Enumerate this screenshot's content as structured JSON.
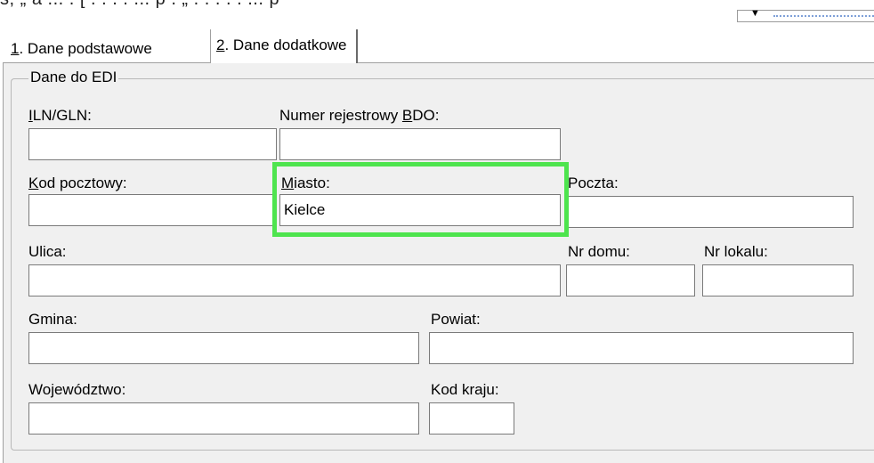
{
  "top_strip": {
    "clipped_text": "ś, „ a ... . [ . . . . ... p . „ . . . . . ... p"
  },
  "tabs": [
    {
      "key": "1",
      "label": "Dane podstawowe"
    },
    {
      "key": "2",
      "label": "Dane dodatkowe"
    }
  ],
  "group": {
    "title": "Dane do EDI"
  },
  "fields": {
    "iln": {
      "label_key": "I",
      "label_rest": "LN/GLN:",
      "value": ""
    },
    "bdo": {
      "label_pre": "Numer rejestrowy ",
      "label_key": "B",
      "label_rest": "DO:",
      "value": ""
    },
    "kod_pocztowy": {
      "label_key": "K",
      "label_rest": "od pocztowy:",
      "value": ""
    },
    "miasto": {
      "label_key": "M",
      "label_rest": "iasto:",
      "value": "Kielce"
    },
    "poczta": {
      "label": "Poczta:",
      "value": ""
    },
    "ulica": {
      "label": "Ulica:",
      "value": ""
    },
    "nr_domu": {
      "label": "Nr domu:",
      "value": ""
    },
    "nr_lokalu": {
      "label": "Nr lokalu:",
      "value": ""
    },
    "gmina": {
      "label": "Gmina:",
      "value": ""
    },
    "powiat": {
      "label": "Powiat:",
      "value": ""
    },
    "wojewodztwo": {
      "label": "Województwo:",
      "value": ""
    },
    "kod_kraju": {
      "label": "Kod kraju:",
      "value": ""
    }
  },
  "colors": {
    "highlight": "#4ee44e",
    "panel": "#f0f0f0"
  }
}
